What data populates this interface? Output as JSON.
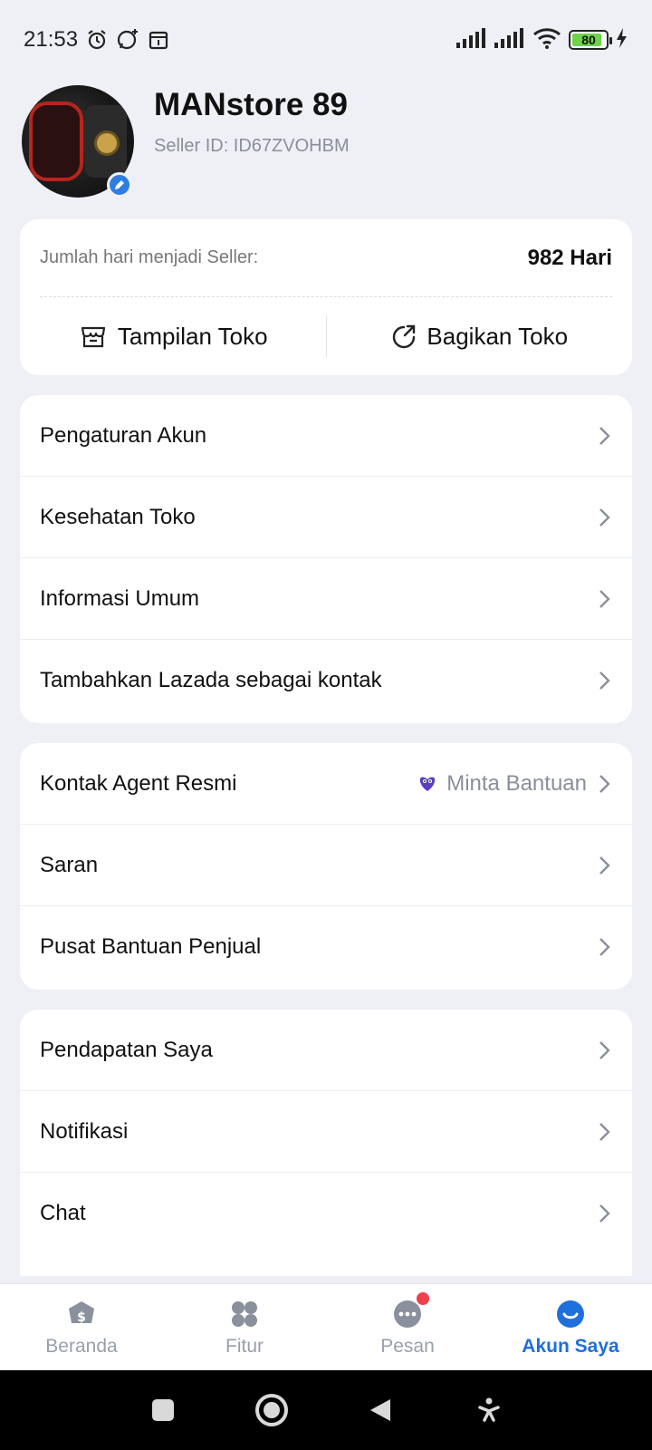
{
  "status_bar": {
    "time": "21:53",
    "battery": "80"
  },
  "profile": {
    "store_name": "MANstore 89",
    "seller_id": "Seller ID: ID67ZVOHBM"
  },
  "stats": {
    "label": "Jumlah hari menjadi Seller:",
    "value": "982 Hari"
  },
  "actions": {
    "store_view": "Tampilan Toko",
    "share_store": "Bagikan Toko"
  },
  "menu_group1": [
    {
      "label": "Pengaturan Akun"
    },
    {
      "label": "Kesehatan Toko"
    },
    {
      "label": "Informasi Umum"
    },
    {
      "label": "Tambahkan Lazada sebagai kontak"
    }
  ],
  "menu_group2": [
    {
      "label": "Kontak Agent Resmi",
      "extra": "Minta Bantuan"
    },
    {
      "label": "Saran"
    },
    {
      "label": "Pusat Bantuan Penjual"
    }
  ],
  "menu_group3": [
    {
      "label": "Pendapatan Saya"
    },
    {
      "label": "Notifikasi"
    },
    {
      "label": "Chat"
    }
  ],
  "bottom_nav": [
    {
      "label": "Beranda",
      "icon": "home-shield-icon"
    },
    {
      "label": "Fitur",
      "icon": "features-grid-icon"
    },
    {
      "label": "Pesan",
      "icon": "message-icon"
    },
    {
      "label": "Akun Saya",
      "icon": "account-icon"
    }
  ],
  "colors": {
    "accent": "#1f6fdc",
    "badge": "#f0404a",
    "background": "#eef0f5"
  }
}
